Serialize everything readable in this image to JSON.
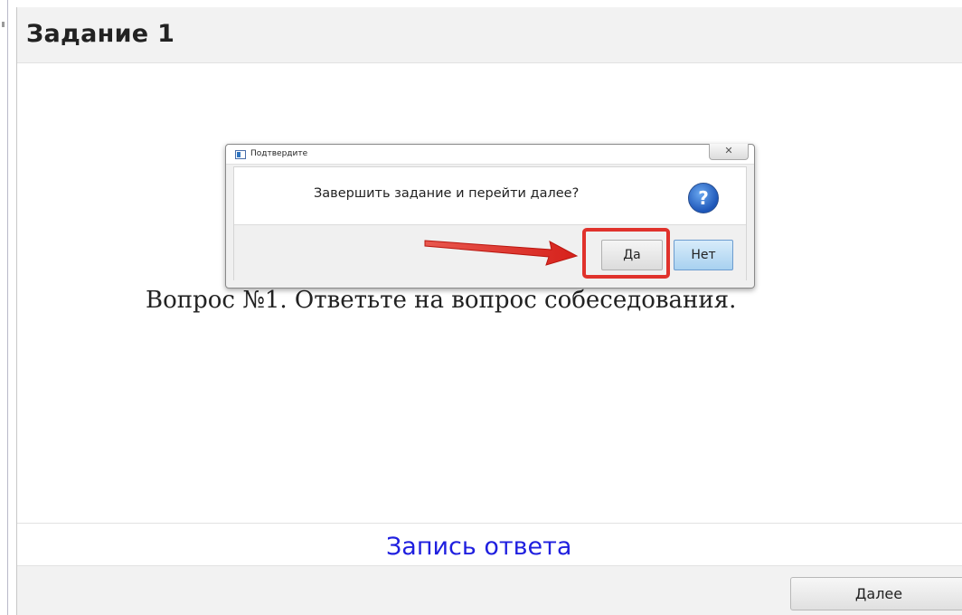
{
  "window": {
    "title": "Задание 1"
  },
  "main": {
    "question": "Вопрос №1. Ответьте на вопрос собеседования.",
    "record_link": "Запись ответа"
  },
  "footer": {
    "next_label": "Далее"
  },
  "dialog": {
    "title": "Подтвердите",
    "close_glyph": "✕",
    "message": "Завершить задание и перейти далее?",
    "icon": "help-icon",
    "icon_glyph": "?",
    "yes_label": "Да",
    "no_label": "Нет"
  },
  "annotations": {
    "arrow_icon": "arrow-right-icon",
    "highlight_color": "#e0322c"
  },
  "colors": {
    "link": "#1f1fdf",
    "help_icon": "#1d56b8",
    "no_button": "#a8d1f0"
  }
}
